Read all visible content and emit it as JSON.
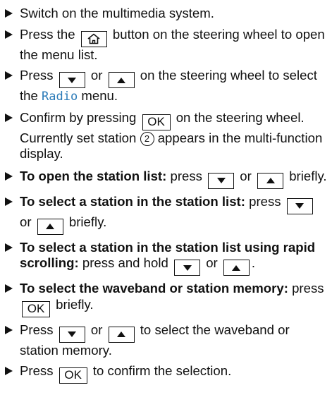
{
  "icons": {
    "home": "home-icon",
    "down": "down-arrow-icon",
    "up": "up-arrow-icon"
  },
  "colors": {
    "menu_name": "#2a7ab8",
    "text": "#111111"
  },
  "steps": [
    {
      "text": "Switch on the multimedia system."
    },
    {
      "before": "Press the",
      "after": "button on the steering wheel to open the menu list."
    },
    {
      "before": "Press",
      "or": "or",
      "after1": "on the steering wheel to select the",
      "menu": "Radio",
      "after2": "menu."
    },
    {
      "before": "Confirm by pressing",
      "ok": "OK",
      "after": "on the steering wheel.",
      "result_before": "Currently set station",
      "ref": "2",
      "result_after": "appears in the multi-function display."
    },
    {
      "label": "To open the station list:",
      "before": "press",
      "or": "or",
      "after": "briefly."
    },
    {
      "label": "To select a station in the station list:",
      "before": "press",
      "or": "or",
      "after": "briefly."
    },
    {
      "label": "To select a station in the station list using rapid scrolling:",
      "before": "press and hold",
      "or": "or",
      "after": "."
    },
    {
      "label": "To select the waveband or station memory:",
      "before": "press",
      "ok": "OK",
      "after": "briefly."
    },
    {
      "before": "Press",
      "or": "or",
      "after": "to select the waveband or station memory."
    },
    {
      "before": "Press",
      "ok": "OK",
      "after": "to confirm the selection."
    }
  ]
}
